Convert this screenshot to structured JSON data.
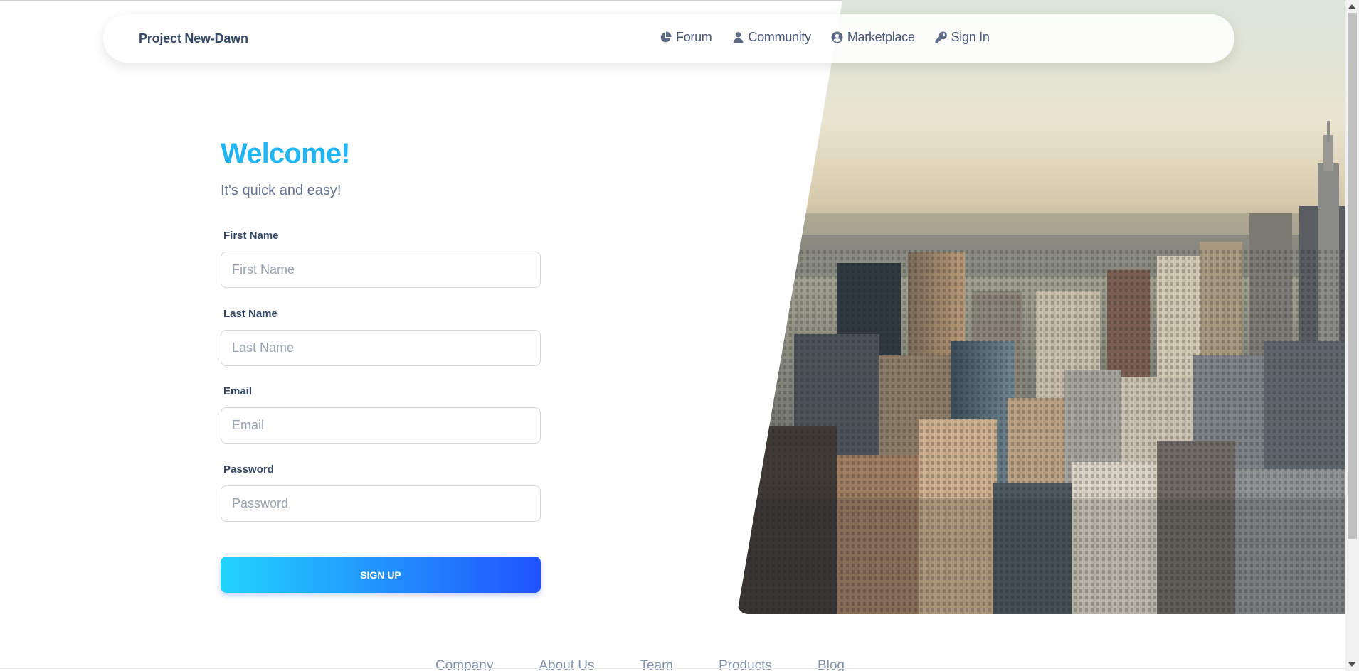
{
  "navbar": {
    "brand": "Project New-Dawn",
    "links": [
      {
        "label": "Forum",
        "icon": "pie-chart-icon"
      },
      {
        "label": "Community",
        "icon": "user-icon"
      },
      {
        "label": "Marketplace",
        "icon": "user-circle-icon"
      },
      {
        "label": "Sign In",
        "icon": "key-icon"
      }
    ]
  },
  "form": {
    "title": "Welcome!",
    "subtitle": "It's quick and easy!",
    "fields": [
      {
        "label": "First Name",
        "placeholder": "First Name",
        "value": ""
      },
      {
        "label": "Last Name",
        "placeholder": "Last Name",
        "value": ""
      },
      {
        "label": "Email",
        "placeholder": "Email",
        "value": ""
      },
      {
        "label": "Password",
        "placeholder": "Password",
        "value": ""
      }
    ],
    "submit_label": "SIGN UP"
  },
  "hero": {
    "image": "city-skyline-image"
  },
  "footer": {
    "links": [
      "Company",
      "About Us",
      "Team",
      "Products",
      "Blog"
    ]
  },
  "colors": {
    "accent": "#21b6f3",
    "gradient_start": "#21d4fd",
    "gradient_end": "#2152ff",
    "text_dark": "#344767",
    "text_muted": "#67748e"
  }
}
